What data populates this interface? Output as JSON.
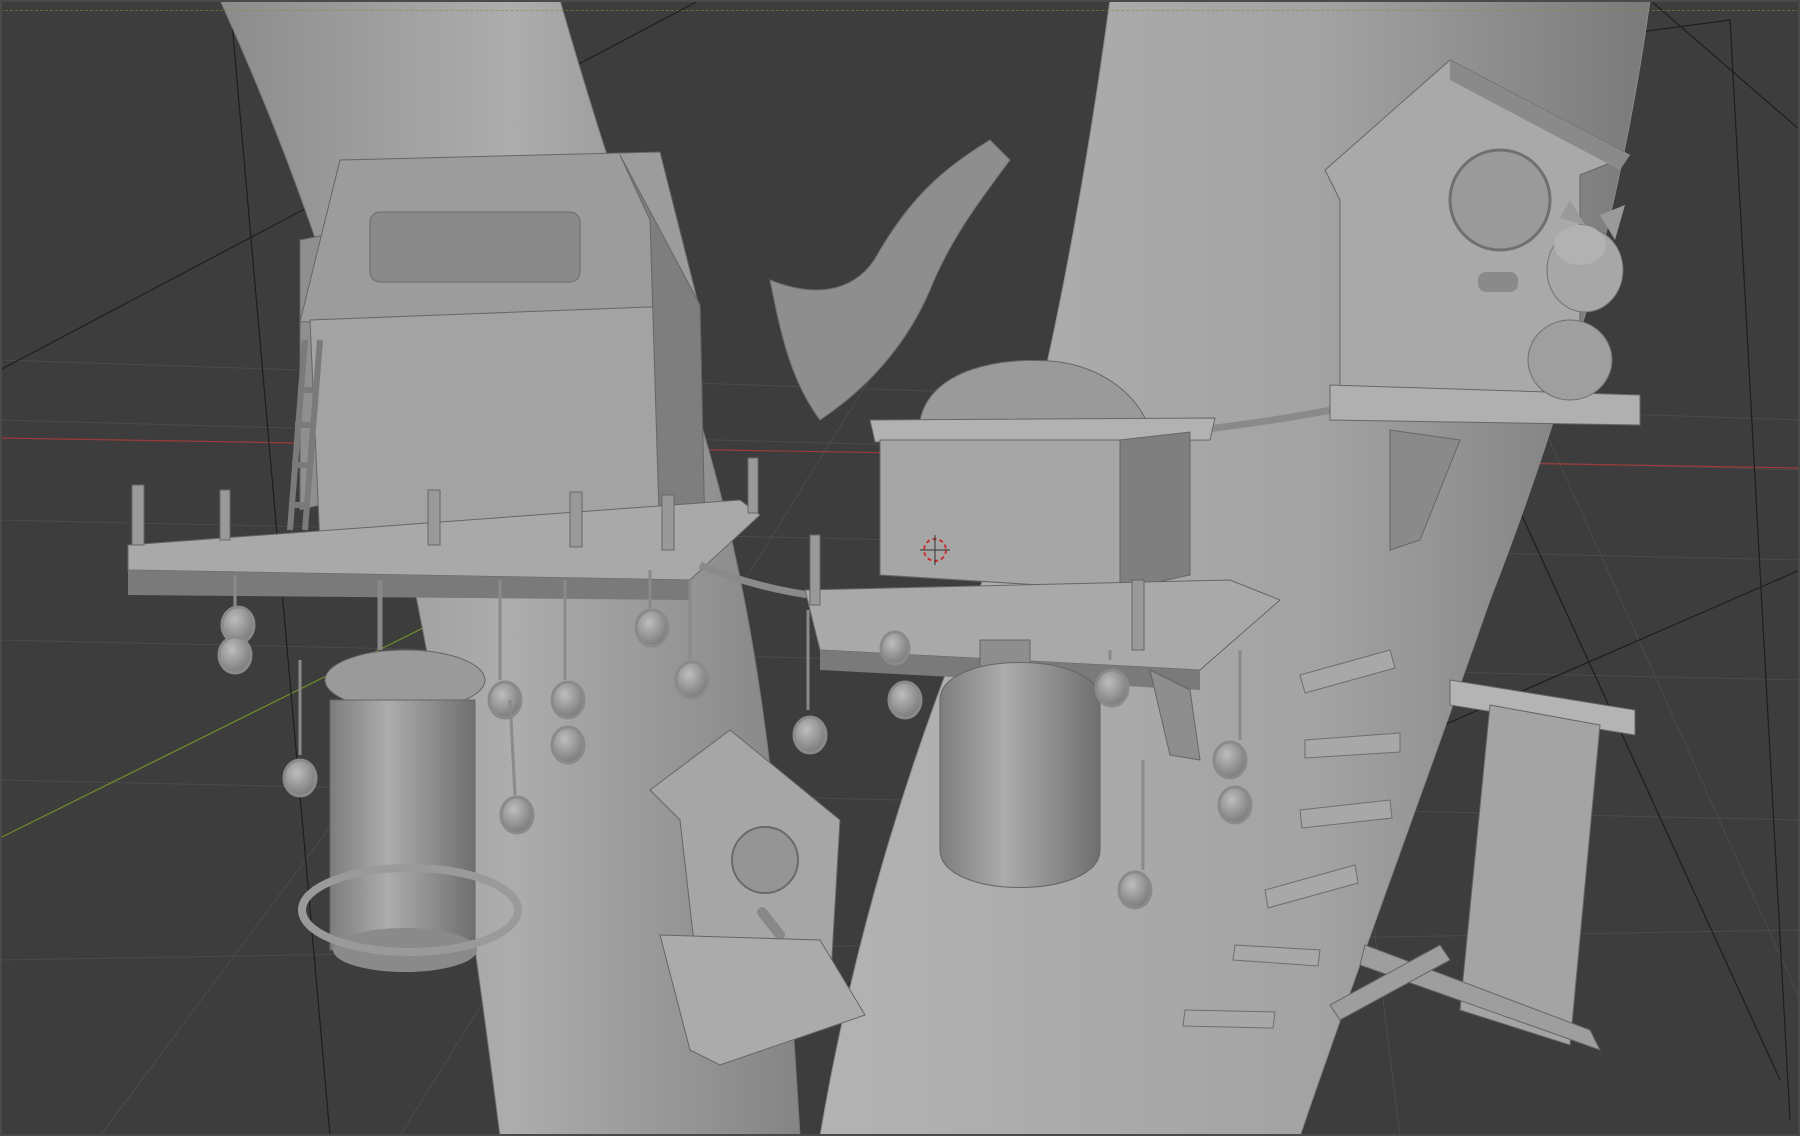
{
  "app": {
    "name": "",
    "view": "3D Viewport",
    "shading": "solid"
  },
  "scene": {
    "objects": [
      "tree-trunk-left",
      "tree-trunk-right",
      "tree-branch",
      "treehouse-large",
      "treehouse-small",
      "birdhouse-top-right",
      "birdhouse-bottom",
      "squirrel",
      "lantern-feeder",
      "bell-feeder",
      "acorn-strings",
      "ladder",
      "step-planks",
      "signpost"
    ],
    "colors": {
      "background": "#3d3d3d",
      "grid": "#4a4a4a",
      "model": "#9a9a9a",
      "model_light": "#b6b6b6",
      "model_dark": "#6e6e6e",
      "axis_x": "#9b3b3b",
      "axis_y": "#6f8f2a",
      "cursor": "#c83030"
    }
  }
}
